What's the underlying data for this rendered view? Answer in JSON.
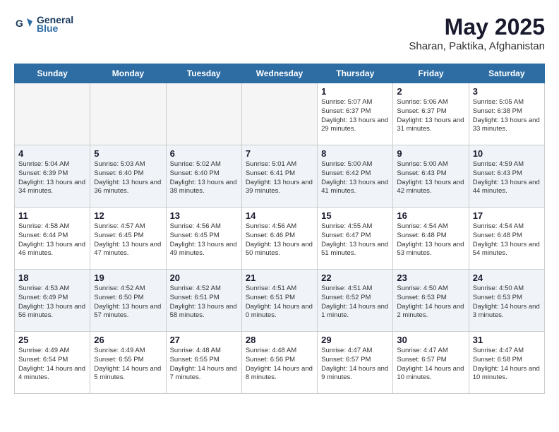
{
  "header": {
    "logo_line1": "General",
    "logo_line2": "Blue",
    "month": "May 2025",
    "location": "Sharan, Paktika, Afghanistan"
  },
  "days_of_week": [
    "Sunday",
    "Monday",
    "Tuesday",
    "Wednesday",
    "Thursday",
    "Friday",
    "Saturday"
  ],
  "weeks": [
    [
      {
        "day": "",
        "empty": true
      },
      {
        "day": "",
        "empty": true
      },
      {
        "day": "",
        "empty": true
      },
      {
        "day": "",
        "empty": true
      },
      {
        "day": "1",
        "sunrise": "5:07 AM",
        "sunset": "6:37 PM",
        "daylight": "13 hours and 29 minutes."
      },
      {
        "day": "2",
        "sunrise": "5:06 AM",
        "sunset": "6:37 PM",
        "daylight": "13 hours and 31 minutes."
      },
      {
        "day": "3",
        "sunrise": "5:05 AM",
        "sunset": "6:38 PM",
        "daylight": "13 hours and 33 minutes."
      }
    ],
    [
      {
        "day": "4",
        "sunrise": "5:04 AM",
        "sunset": "6:39 PM",
        "daylight": "13 hours and 34 minutes."
      },
      {
        "day": "5",
        "sunrise": "5:03 AM",
        "sunset": "6:40 PM",
        "daylight": "13 hours and 36 minutes."
      },
      {
        "day": "6",
        "sunrise": "5:02 AM",
        "sunset": "6:40 PM",
        "daylight": "13 hours and 38 minutes."
      },
      {
        "day": "7",
        "sunrise": "5:01 AM",
        "sunset": "6:41 PM",
        "daylight": "13 hours and 39 minutes."
      },
      {
        "day": "8",
        "sunrise": "5:00 AM",
        "sunset": "6:42 PM",
        "daylight": "13 hours and 41 minutes."
      },
      {
        "day": "9",
        "sunrise": "5:00 AM",
        "sunset": "6:43 PM",
        "daylight": "13 hours and 42 minutes."
      },
      {
        "day": "10",
        "sunrise": "4:59 AM",
        "sunset": "6:43 PM",
        "daylight": "13 hours and 44 minutes."
      }
    ],
    [
      {
        "day": "11",
        "sunrise": "4:58 AM",
        "sunset": "6:44 PM",
        "daylight": "13 hours and 46 minutes."
      },
      {
        "day": "12",
        "sunrise": "4:57 AM",
        "sunset": "6:45 PM",
        "daylight": "13 hours and 47 minutes."
      },
      {
        "day": "13",
        "sunrise": "4:56 AM",
        "sunset": "6:45 PM",
        "daylight": "13 hours and 49 minutes."
      },
      {
        "day": "14",
        "sunrise": "4:56 AM",
        "sunset": "6:46 PM",
        "daylight": "13 hours and 50 minutes."
      },
      {
        "day": "15",
        "sunrise": "4:55 AM",
        "sunset": "6:47 PM",
        "daylight": "13 hours and 51 minutes."
      },
      {
        "day": "16",
        "sunrise": "4:54 AM",
        "sunset": "6:48 PM",
        "daylight": "13 hours and 53 minutes."
      },
      {
        "day": "17",
        "sunrise": "4:54 AM",
        "sunset": "6:48 PM",
        "daylight": "13 hours and 54 minutes."
      }
    ],
    [
      {
        "day": "18",
        "sunrise": "4:53 AM",
        "sunset": "6:49 PM",
        "daylight": "13 hours and 56 minutes."
      },
      {
        "day": "19",
        "sunrise": "4:52 AM",
        "sunset": "6:50 PM",
        "daylight": "13 hours and 57 minutes."
      },
      {
        "day": "20",
        "sunrise": "4:52 AM",
        "sunset": "6:51 PM",
        "daylight": "13 hours and 58 minutes."
      },
      {
        "day": "21",
        "sunrise": "4:51 AM",
        "sunset": "6:51 PM",
        "daylight": "14 hours and 0 minutes."
      },
      {
        "day": "22",
        "sunrise": "4:51 AM",
        "sunset": "6:52 PM",
        "daylight": "14 hours and 1 minute."
      },
      {
        "day": "23",
        "sunrise": "4:50 AM",
        "sunset": "6:53 PM",
        "daylight": "14 hours and 2 minutes."
      },
      {
        "day": "24",
        "sunrise": "4:50 AM",
        "sunset": "6:53 PM",
        "daylight": "14 hours and 3 minutes."
      }
    ],
    [
      {
        "day": "25",
        "sunrise": "4:49 AM",
        "sunset": "6:54 PM",
        "daylight": "14 hours and 4 minutes."
      },
      {
        "day": "26",
        "sunrise": "4:49 AM",
        "sunset": "6:55 PM",
        "daylight": "14 hours and 5 minutes."
      },
      {
        "day": "27",
        "sunrise": "4:48 AM",
        "sunset": "6:55 PM",
        "daylight": "14 hours and 7 minutes."
      },
      {
        "day": "28",
        "sunrise": "4:48 AM",
        "sunset": "6:56 PM",
        "daylight": "14 hours and 8 minutes."
      },
      {
        "day": "29",
        "sunrise": "4:47 AM",
        "sunset": "6:57 PM",
        "daylight": "14 hours and 9 minutes."
      },
      {
        "day": "30",
        "sunrise": "4:47 AM",
        "sunset": "6:57 PM",
        "daylight": "14 hours and 10 minutes."
      },
      {
        "day": "31",
        "sunrise": "4:47 AM",
        "sunset": "6:58 PM",
        "daylight": "14 hours and 10 minutes."
      }
    ]
  ],
  "labels": {
    "sunrise": "Sunrise:",
    "sunset": "Sunset:",
    "daylight": "Daylight:"
  }
}
